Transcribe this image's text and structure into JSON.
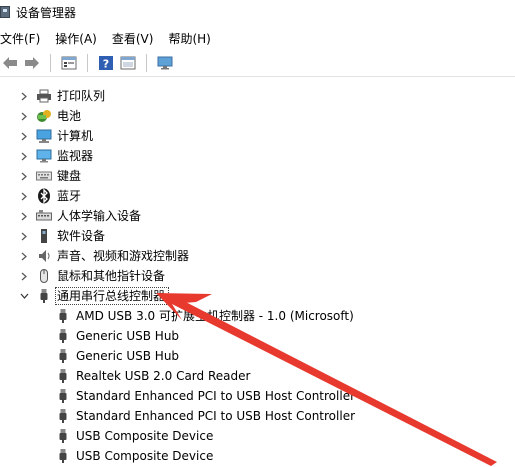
{
  "window": {
    "title": "设备管理器"
  },
  "menu": [
    {
      "label": "文件(F)"
    },
    {
      "label": "操作(A)"
    },
    {
      "label": "查看(V)"
    },
    {
      "label": "帮助(H)"
    }
  ],
  "toolbar": {
    "icons": [
      "back-arrow-icon",
      "forward-arrow-icon",
      "properties-icon",
      "help-icon",
      "console-icon",
      "monitor-scan-icon"
    ]
  },
  "tree": {
    "categories": [
      {
        "label": "打印队列",
        "icon": "printer-icon",
        "expanded": false
      },
      {
        "label": "电池",
        "icon": "battery-icon",
        "expanded": false
      },
      {
        "label": "计算机",
        "icon": "computer-icon",
        "expanded": false
      },
      {
        "label": "监视器",
        "icon": "monitor-icon",
        "expanded": false
      },
      {
        "label": "键盘",
        "icon": "keyboard-icon",
        "expanded": false
      },
      {
        "label": "蓝牙",
        "icon": "bluetooth-icon",
        "expanded": false
      },
      {
        "label": "人体学输入设备",
        "icon": "hid-icon",
        "expanded": false
      },
      {
        "label": "软件设备",
        "icon": "software-device-icon",
        "expanded": false
      },
      {
        "label": "声音、视频和游戏控制器",
        "icon": "speaker-icon",
        "expanded": false
      },
      {
        "label": "鼠标和其他指针设备",
        "icon": "mouse-icon",
        "expanded": false
      },
      {
        "label": "通用串行总线控制器",
        "icon": "usb-icon",
        "expanded": true
      }
    ],
    "usb_children": [
      {
        "label": "AMD USB 3.0 可扩展主机控制器 - 1.0 (Microsoft)"
      },
      {
        "label": "Generic USB Hub"
      },
      {
        "label": "Generic USB Hub"
      },
      {
        "label": "Realtek USB 2.0 Card Reader"
      },
      {
        "label": "Standard Enhanced PCI to USB Host Controller"
      },
      {
        "label": "Standard Enhanced PCI to USB Host Controller"
      },
      {
        "label": "USB Composite Device"
      },
      {
        "label": "USB Composite Device"
      }
    ]
  },
  "colors": {
    "arrow": "#e8392f"
  }
}
